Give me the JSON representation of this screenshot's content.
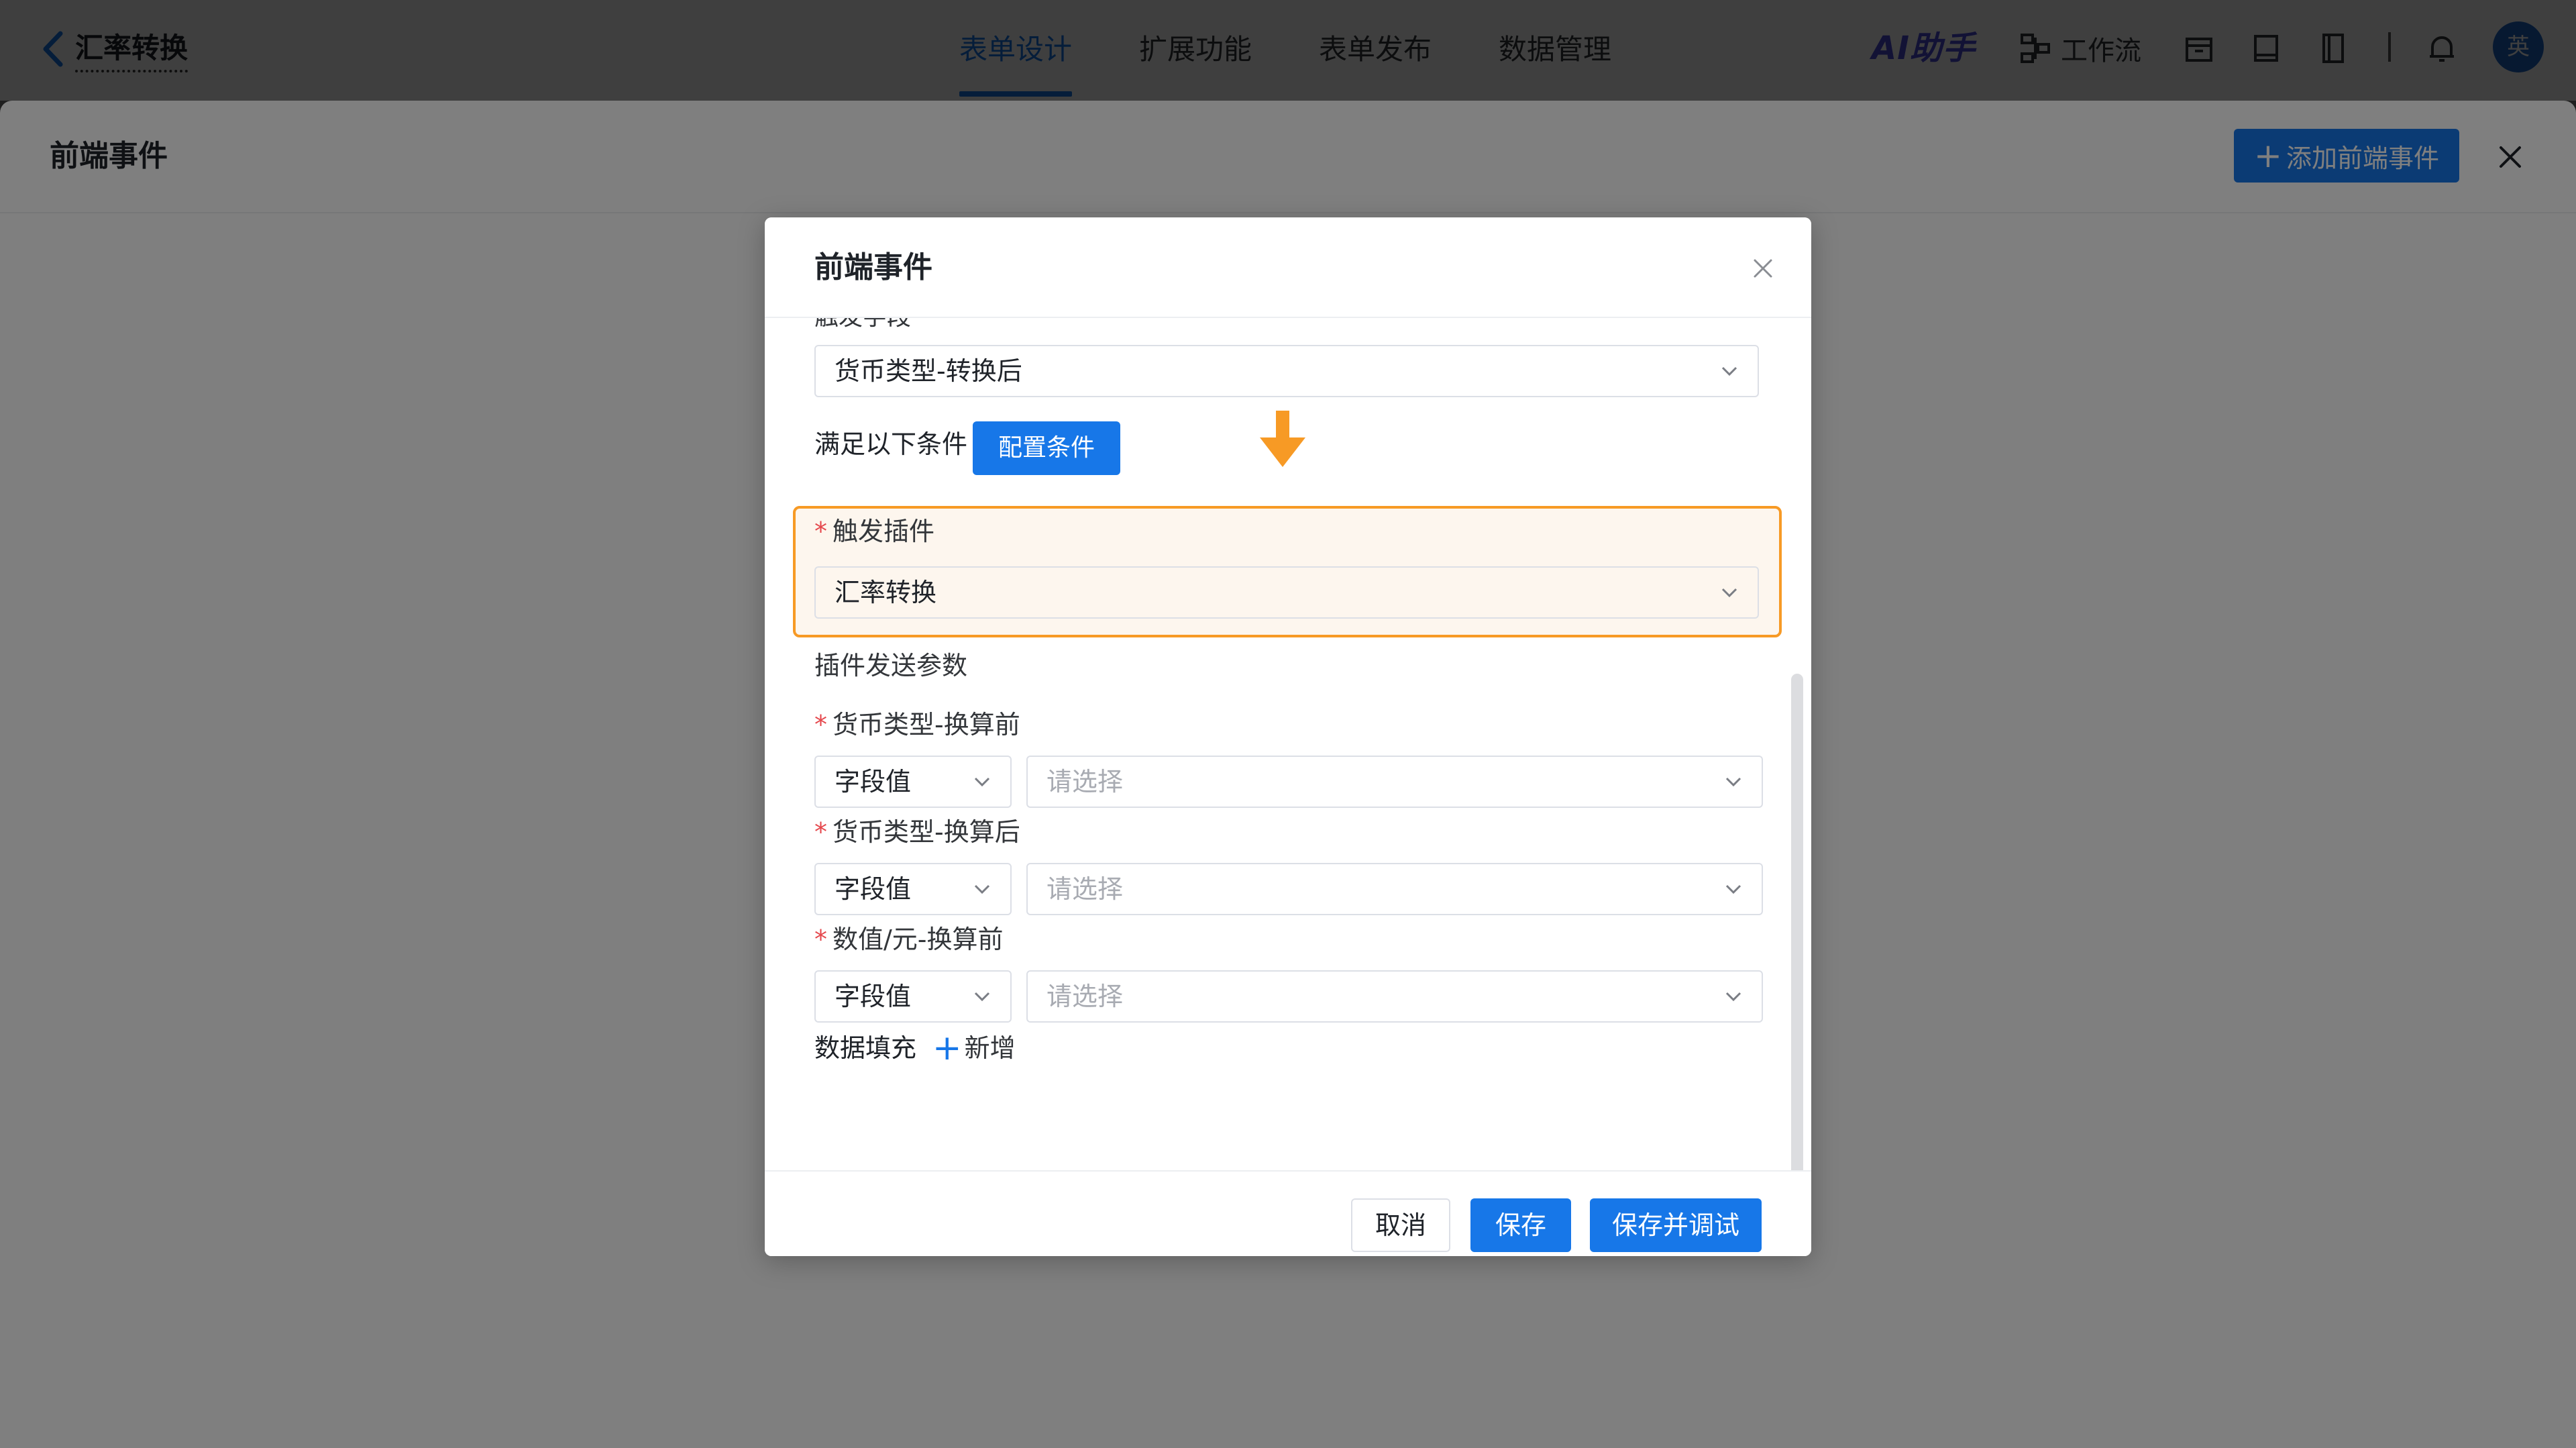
{
  "header": {
    "back_icon": "chevron-left-icon",
    "app_title": "汇率转换",
    "tabs": [
      {
        "label": "表单设计",
        "active": true
      },
      {
        "label": "扩展功能",
        "active": false
      },
      {
        "label": "表单发布",
        "active": false
      },
      {
        "label": "数据管理",
        "active": false
      }
    ],
    "ai_label": "AI助手",
    "workflow_label": "工作流",
    "icons": [
      "store-icon",
      "book-icon",
      "notebook-icon",
      "bell-icon"
    ],
    "avatar_text": "英"
  },
  "drawer": {
    "title": "前端事件",
    "add_button": "添加前端事件",
    "close_icon": "close-icon"
  },
  "modal": {
    "title": "前端事件",
    "clipped_label": "触发字段",
    "trigger_field_value": "货币类型-转换后",
    "condition_label": "满足以下条件",
    "condition_button": "配置条件",
    "plugin": {
      "label": "触发插件",
      "value": "汇率转换"
    },
    "params_section": "插件发送参数",
    "params": [
      {
        "label": "货币类型-换算前",
        "type": "字段值",
        "placeholder": "请选择"
      },
      {
        "label": "货币类型-换算后",
        "type": "字段值",
        "placeholder": "请选择"
      },
      {
        "label": "数值/元-换算前",
        "type": "字段值",
        "placeholder": "请选择"
      }
    ],
    "fill_label": "数据填充",
    "fill_add": "新增",
    "footer": {
      "cancel": "取消",
      "save": "保存",
      "save_debug": "保存并调试"
    }
  },
  "colors": {
    "primary": "#1777e8",
    "highlight_border": "#f79a25",
    "required": "#e5484d"
  }
}
